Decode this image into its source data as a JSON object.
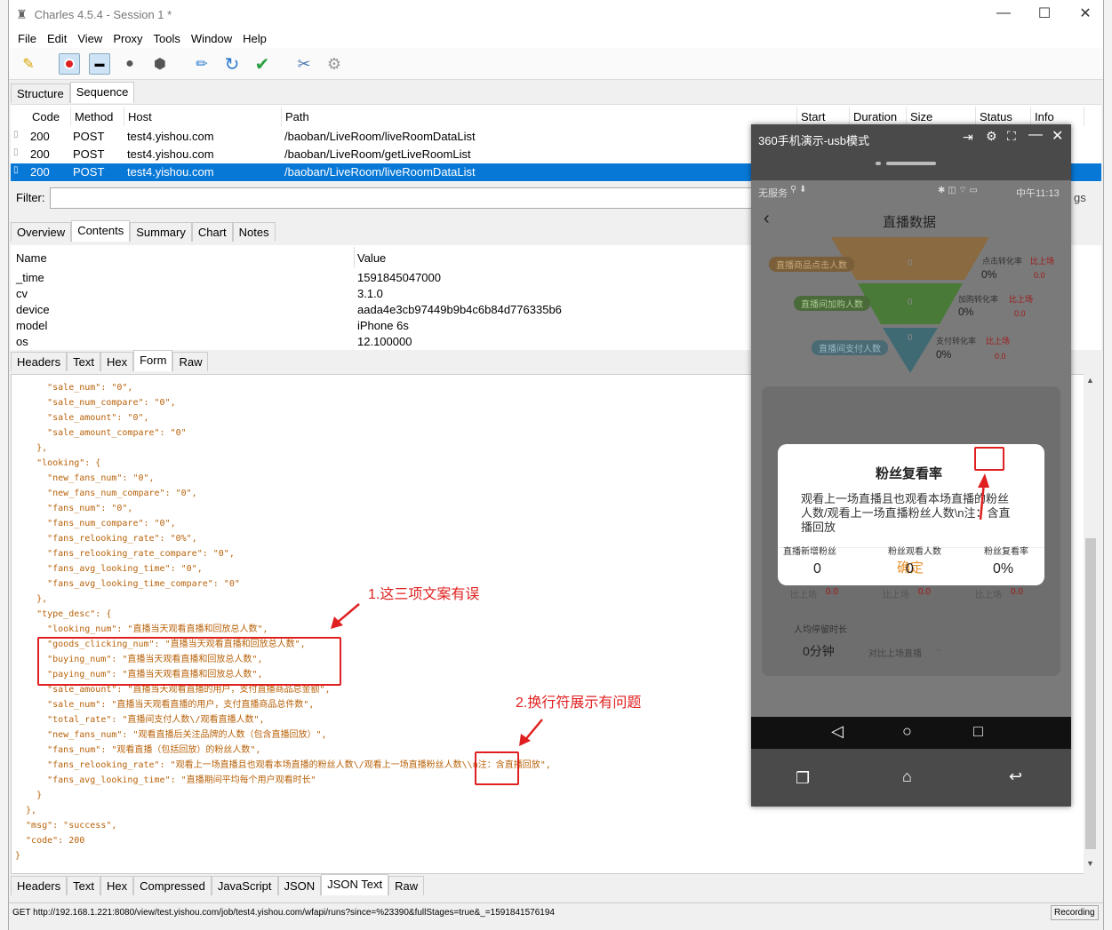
{
  "window": {
    "title": "Charles 4.5.4 - Session 1 *",
    "minimize": "—",
    "maximize": "☐",
    "close": "✕"
  },
  "menu": [
    "File",
    "Edit",
    "View",
    "Proxy",
    "Tools",
    "Window",
    "Help"
  ],
  "toolbar_icons": [
    "broom-icon",
    "record-icon",
    "throttle-icon",
    "turtle-icon",
    "stop-icon",
    "pen-icon",
    "refresh-icon",
    "check-icon",
    "tools-icon",
    "settings-icon"
  ],
  "view_tabs": [
    "Structure",
    "Sequence"
  ],
  "sequence": {
    "headers": [
      "Code",
      "Method",
      "Host",
      "Path",
      "Start",
      "Duration",
      "Size",
      "Status",
      "Info"
    ],
    "rows": [
      {
        "code": "200",
        "method": "POST",
        "host": "test4.yishou.com",
        "path": "/baoban/LiveRoom/liveRoomDataList"
      },
      {
        "code": "200",
        "method": "POST",
        "host": "test4.yishou.com",
        "path": "/baoban/LiveRoom/getLiveRoomList"
      },
      {
        "code": "200",
        "method": "POST",
        "host": "test4.yishou.com",
        "path": "/baoban/LiveRoom/liveRoomDataList"
      }
    ]
  },
  "filter": {
    "label": "Filter:",
    "settings_label": "gs"
  },
  "detail_tabs": [
    "Overview",
    "Contents",
    "Summary",
    "Chart",
    "Notes"
  ],
  "form": {
    "headers": [
      "Name",
      "Value"
    ],
    "rows": [
      {
        "name": "_time",
        "value": "1591845047000"
      },
      {
        "name": "cv",
        "value": "3.1.0"
      },
      {
        "name": "device",
        "value": "aada4e3cb97449b9b4c6b84d776335b6"
      },
      {
        "name": "model",
        "value": "iPhone 6s"
      },
      {
        "name": "os",
        "value": "12.100000"
      }
    ]
  },
  "request_tabs": [
    "Headers",
    "Text",
    "Hex",
    "Form",
    "Raw"
  ],
  "response_tabs": [
    "Headers",
    "Text",
    "Hex",
    "Compressed",
    "JavaScript",
    "JSON",
    "JSON Text",
    "Raw"
  ],
  "json_lines": [
    "      \"sale_num\": \"0\",",
    "      \"sale_num_compare\": \"0\",",
    "      \"sale_amount\": \"0\",",
    "      \"sale_amount_compare\": \"0\"",
    "    },",
    "    \"looking\": {",
    "      \"new_fans_num\": \"0\",",
    "      \"new_fans_num_compare\": \"0\",",
    "      \"fans_num\": \"0\",",
    "      \"fans_num_compare\": \"0\",",
    "      \"fans_relooking_rate\": \"0%\",",
    "      \"fans_relooking_rate_compare\": \"0\",",
    "      \"fans_avg_looking_time\": \"0\",",
    "      \"fans_avg_looking_time_compare\": \"0\"",
    "    },",
    "    \"type_desc\": {",
    "      \"looking_num\": \"直播当天观看直播和回放总人数\",",
    "      \"goods_clicking_num\": \"直播当天观看直播和回放总人数\",",
    "      \"buying_num\": \"直播当天观看直播和回放总人数\",",
    "      \"paying_num\": \"直播当天观看直播和回放总人数\",",
    "      \"sale_amount\": \"直播当天观看直播的用户，支付直播商品总金额\",",
    "      \"sale_num\": \"直播当天观看直播的用户，支付直播商品总件数\",",
    "      \"total_rate\": \"直播间支付人数\\/观看直播人数\",",
    "      \"new_fans_num\": \"观看直播后关注品牌的人数（包含直播回放）\",",
    "      \"fans_num\": \"观看直播（包括回放）的粉丝人数\",",
    "      \"fans_relooking_rate\": \"观看上一场直播且也观看本场直播的粉丝人数\\/观看上一场直播粉丝人数\\\\n注：含直播回放\",",
    "      \"fans_avg_looking_time\": \"直播期间平均每个用户观看时长\"",
    "    }",
    "  },",
    "  \"msg\": \"success\",",
    "  \"code\": 200",
    "}"
  ],
  "annotations": {
    "label1": "1.这三项文案有误",
    "label2": "2.换行符展示有问题"
  },
  "statusbar": {
    "url": "GET http://192.168.1.221:8080/view/test.yishou.com/job/test4.yishou.com/wfapi/runs?since=%23390&fullStages=true&_=1591841576194",
    "recording": "Recording"
  },
  "phone": {
    "window_title": "360手机演示-usb模式",
    "status_left": "无服务",
    "status_time": "中午11:13",
    "page_title": "直播数据",
    "funnel": [
      {
        "label": "直播商品点击人数",
        "value": "0"
      },
      {
        "label": "直播间加购人数",
        "value": "0"
      },
      {
        "label": "直播间支付人数",
        "value": "0"
      }
    ],
    "rates": [
      {
        "label": "点击转化率",
        "compare": "比上场",
        "value": "0%",
        "delta": "0.0"
      },
      {
        "label": "加购转化率",
        "compare": "比上场",
        "value": "0%",
        "delta": "0.0"
      },
      {
        "label": "支付转化率",
        "compare": "比上场",
        "value": "0%",
        "delta": "0.0"
      }
    ],
    "dialog": {
      "title": "粉丝复看率",
      "body": "观看上一场直播且也观看本场直播的粉丝人数/观看上一场直播粉丝人数\\n注：含直播回放",
      "confirm": "确定"
    },
    "stats": [
      {
        "label": "直播新增粉丝",
        "value": "0",
        "compare": "比上场",
        "delta": "0.0"
      },
      {
        "label": "粉丝观看人数",
        "value": "0",
        "compare": "比上场",
        "delta": "0.0"
      },
      {
        "label": "粉丝复看率",
        "value": "0%",
        "compare": "比上场",
        "delta": "0.0"
      }
    ],
    "avg_label": "人均停留时长",
    "avg_value": "0分钟",
    "avg_compare": "对比上场直播",
    "avg_dash": "--"
  }
}
